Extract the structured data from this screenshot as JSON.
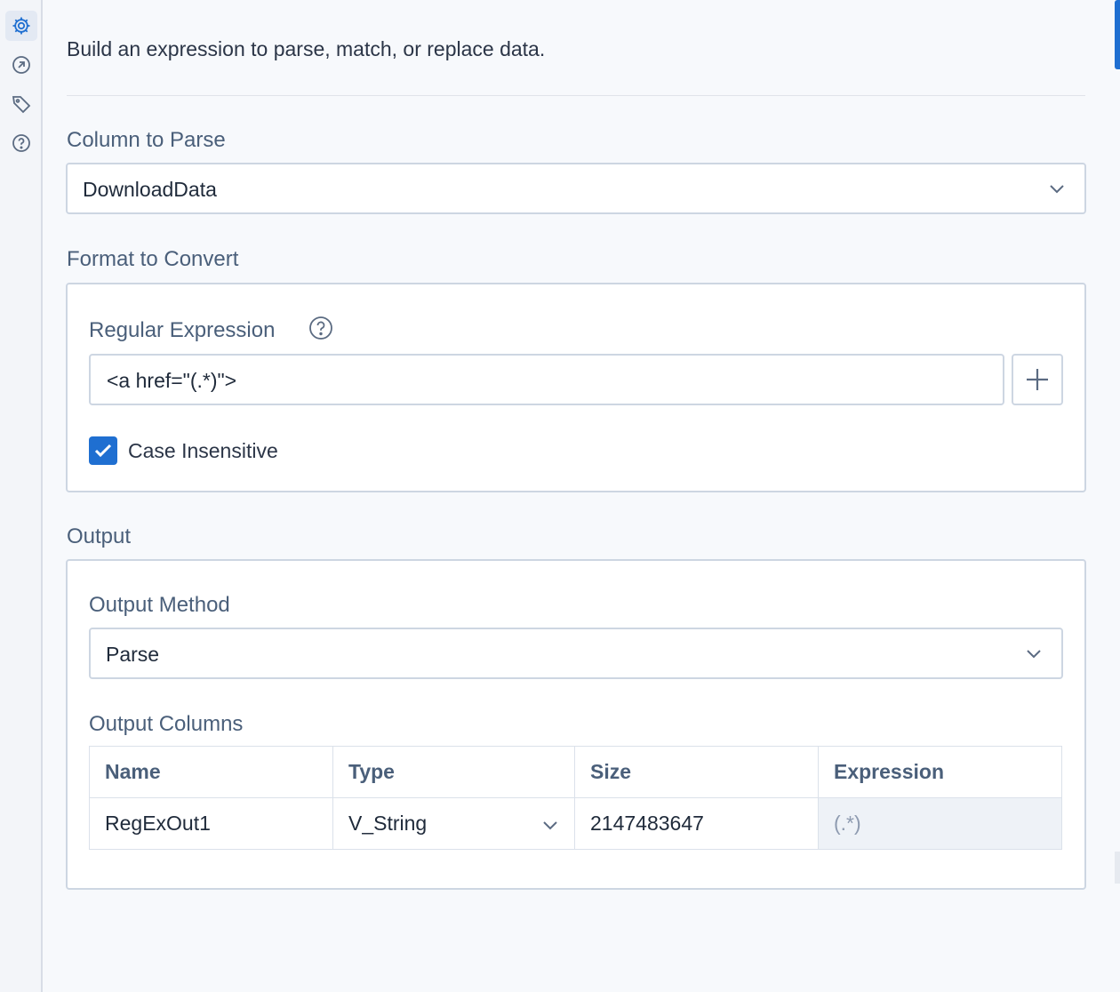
{
  "description": "Build an expression to parse, match, or replace data.",
  "sidebar": {
    "items": [
      {
        "icon": "gear-icon",
        "active": true
      },
      {
        "icon": "arrow-circle-icon",
        "active": false
      },
      {
        "icon": "tag-icon",
        "active": false
      },
      {
        "icon": "help-icon",
        "active": false
      }
    ]
  },
  "column_to_parse": {
    "label": "Column to Parse",
    "value": "DownloadData"
  },
  "format": {
    "label": "Format to Convert",
    "regex_label": "Regular Expression",
    "regex_value": "<a href=\"(.*)\">",
    "case_insensitive_label": "Case Insensitive",
    "case_insensitive_checked": true
  },
  "output": {
    "label": "Output",
    "method_label": "Output Method",
    "method_value": "Parse",
    "columns_label": "Output Columns",
    "headers": [
      "Name",
      "Type",
      "Size",
      "Expression"
    ],
    "rows": [
      {
        "name": "RegExOut1",
        "type": "V_String",
        "size": "2147483647",
        "expression": "(.*)"
      }
    ]
  },
  "colors": {
    "accent": "#1f6fd1",
    "label": "#4a5f7a",
    "border": "#cdd6e2"
  }
}
